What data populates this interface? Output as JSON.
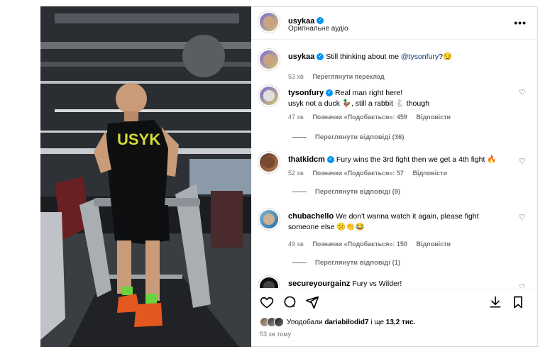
{
  "post": {
    "username": "usykaa",
    "audio_label": "Оригінальне аудіо",
    "more_label": "•••",
    "time_ago": "53 хв тому"
  },
  "caption": {
    "username": "usykaa",
    "text": "Still thinking about me ",
    "mention": "@tysonfury",
    "suffix": "?😏",
    "time": "53 хв",
    "translate_label": "Переглянути переклад"
  },
  "comments": [
    {
      "username": "tysonfury",
      "text": "Real man right here!",
      "text2": "usyk not a duck 🦆, still a rabbit 🐇 though",
      "time": "47 хв",
      "likes": "Позначки «Подобається»: 459",
      "reply_label": "Відповісти",
      "replies_label": "Переглянути відповіді (36)"
    },
    {
      "username": "thatkidcm",
      "text": "Fury wins the 3rd fight then we get a 4th fight 🔥",
      "time": "52 хв",
      "likes": "Позначки «Подобається»: 57",
      "reply_label": "Відповісти",
      "replies_label": "Переглянути відповіді (9)"
    },
    {
      "username": "chubachello",
      "text": "We don't wanna watch it again, please fight",
      "text2": "someone else 😕👏😂",
      "time": "49 хв",
      "likes": "Позначки «Подобається»: 150",
      "reply_label": "Відповісти",
      "replies_label": "Переглянути відповіді (1)"
    },
    {
      "username": "secureyourgainz",
      "text": "Fury vs Wilder!"
    }
  ],
  "likes_bar": {
    "prefix": "Уподобали ",
    "user": "dariabilodid7",
    "middle": " і ще ",
    "count": "13,2 тис."
  },
  "video": {
    "shirt_text": "USYK"
  },
  "icons": {
    "like": "heart-icon",
    "comment": "comment-icon",
    "share": "send-icon",
    "save": "bookmark-icon",
    "download": "download-icon"
  }
}
